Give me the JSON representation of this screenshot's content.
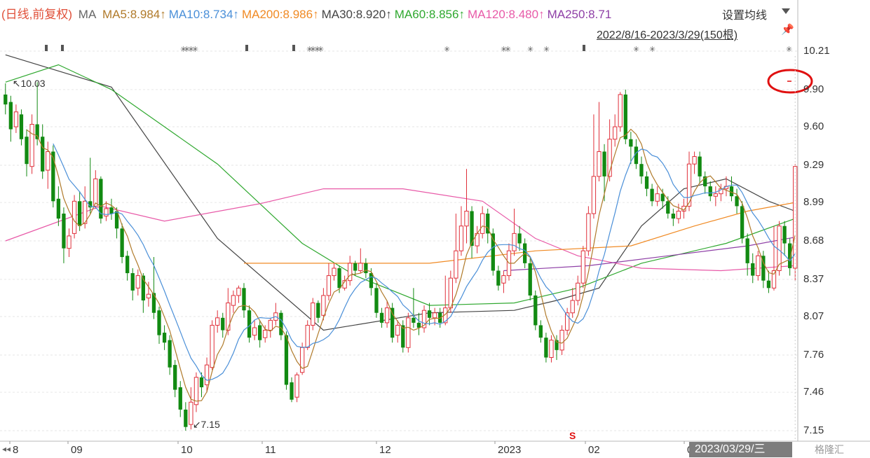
{
  "legend": {
    "mode_label": "(日线,前复权)",
    "ma_label": "MA",
    "items": [
      {
        "text": "MA5:8.984↑",
        "color": "#b07a2a"
      },
      {
        "text": "MA10:8.734↑",
        "color": "#4a8fd8"
      },
      {
        "text": "MA200:8.986↑",
        "color": "#f08a24"
      },
      {
        "text": "MA30:8.920↑",
        "color": "#444444"
      },
      {
        "text": "MA60:8.856↑",
        "color": "#2fa82f"
      },
      {
        "text": "MA120:8.480↑",
        "color": "#e85aa8"
      },
      {
        "text": "MA250:8.71",
        "color": "#8e3fa6"
      }
    ]
  },
  "settings_label": "设置均线",
  "date_range_label": "2022/8/16-2023/3/29(150根)",
  "pin_icon": "pin-icon",
  "cursor_date_label": "2023/03/29/三",
  "watermark": "格隆汇",
  "event_marker": "S",
  "colors": {
    "up": "#e0303a",
    "down": "#128a12",
    "highlight": "#e01010"
  },
  "chart_data": {
    "type": "candlestick",
    "y_ticks": [
      "10.21",
      "9.90",
      "9.60",
      "9.29",
      "8.99",
      "8.68",
      "8.37",
      "8.07",
      "7.76",
      "7.46",
      "7.15"
    ],
    "ylim": [
      7.15,
      10.21
    ],
    "x_labels": [
      "8",
      "09",
      "10",
      "11",
      "12",
      "2023",
      "02",
      "0"
    ],
    "annotations": {
      "high_label": "10.03",
      "low_label": "7.15"
    },
    "candles": [
      [
        9.86,
        9.78,
        9.95,
        9.7
      ],
      [
        9.8,
        9.58,
        9.85,
        9.48
      ],
      [
        9.6,
        9.72,
        9.78,
        9.55
      ],
      [
        9.7,
        9.5,
        9.74,
        9.45
      ],
      [
        9.52,
        9.3,
        9.58,
        9.2
      ],
      [
        9.28,
        9.62,
        9.7,
        9.22
      ],
      [
        9.62,
        9.5,
        9.96,
        9.45
      ],
      [
        9.52,
        9.24,
        9.62,
        9.18
      ],
      [
        9.25,
        9.4,
        9.48,
        9.1
      ],
      [
        9.4,
        9.0,
        9.45,
        8.95
      ],
      [
        9.02,
        8.86,
        9.12,
        8.8
      ],
      [
        8.9,
        8.62,
        8.95,
        8.5
      ],
      [
        8.62,
        8.72,
        8.78,
        8.55
      ],
      [
        8.74,
        9.0,
        9.05,
        8.7
      ],
      [
        9.0,
        8.8,
        9.08,
        8.76
      ],
      [
        8.82,
        9.0,
        9.12,
        8.78
      ],
      [
        9.0,
        8.95,
        9.35,
        8.9
      ],
      [
        8.96,
        9.18,
        9.25,
        8.94
      ],
      [
        9.18,
        8.86,
        9.2,
        8.82
      ],
      [
        8.88,
        8.94,
        9.0,
        8.84
      ],
      [
        8.95,
        8.9,
        9.02,
        8.85
      ],
      [
        8.92,
        8.78,
        8.95,
        8.7
      ],
      [
        8.78,
        8.55,
        8.82,
        8.5
      ],
      [
        8.56,
        8.42,
        8.6,
        8.36
      ],
      [
        8.42,
        8.28,
        8.46,
        8.2
      ],
      [
        8.3,
        8.4,
        8.45,
        8.24
      ],
      [
        8.4,
        8.2,
        8.42,
        8.1
      ],
      [
        8.22,
        8.25,
        8.35,
        8.15
      ],
      [
        8.26,
        8.1,
        8.55,
        8.05
      ],
      [
        8.12,
        7.92,
        8.15,
        7.85
      ],
      [
        7.94,
        7.86,
        8.0,
        7.8
      ],
      [
        7.88,
        7.66,
        7.92,
        7.6
      ],
      [
        7.68,
        7.48,
        7.72,
        7.42
      ],
      [
        7.5,
        7.32,
        7.55,
        7.26
      ],
      [
        7.32,
        7.18,
        7.38,
        7.15
      ],
      [
        7.2,
        7.38,
        7.5,
        7.16
      ],
      [
        7.36,
        7.58,
        7.62,
        7.3
      ],
      [
        7.58,
        7.5,
        7.62,
        7.42
      ],
      [
        7.52,
        7.68,
        7.74,
        7.46
      ],
      [
        7.66,
        8.0,
        8.04,
        7.64
      ],
      [
        8.0,
        8.06,
        8.12,
        7.94
      ],
      [
        8.06,
        7.96,
        8.1,
        7.9
      ],
      [
        7.96,
        8.18,
        8.3,
        7.92
      ],
      [
        8.16,
        8.24,
        8.28,
        8.1
      ],
      [
        8.24,
        8.3,
        8.32,
        8.18
      ],
      [
        8.3,
        8.12,
        8.34,
        8.06
      ],
      [
        8.12,
        7.9,
        8.16,
        7.86
      ],
      [
        7.92,
        7.98,
        8.04,
        7.88
      ],
      [
        8.0,
        7.88,
        8.04,
        7.82
      ],
      [
        7.9,
        7.96,
        8.0,
        7.86
      ],
      [
        7.96,
        8.04,
        8.06,
        7.9
      ],
      [
        8.04,
        8.1,
        8.18,
        8.0
      ],
      [
        8.1,
        7.92,
        8.12,
        7.88
      ],
      [
        7.92,
        7.52,
        7.95,
        7.48
      ],
      [
        7.54,
        7.4,
        7.58,
        7.38
      ],
      [
        7.42,
        7.6,
        7.62,
        7.38
      ],
      [
        7.62,
        7.82,
        7.86,
        7.6
      ],
      [
        7.82,
        8.0,
        8.04,
        7.8
      ],
      [
        8.0,
        8.18,
        8.22,
        7.96
      ],
      [
        8.18,
        8.06,
        8.2,
        8.02
      ],
      [
        8.08,
        8.24,
        8.3,
        8.04
      ],
      [
        8.24,
        8.4,
        8.5,
        8.2
      ],
      [
        8.4,
        8.46,
        8.5,
        8.36
      ],
      [
        8.46,
        8.3,
        8.48,
        8.26
      ],
      [
        8.3,
        8.36,
        8.4,
        8.28
      ],
      [
        8.36,
        8.5,
        8.56,
        8.32
      ],
      [
        8.5,
        8.44,
        8.52,
        8.4
      ],
      [
        8.44,
        8.5,
        8.62,
        8.42
      ],
      [
        8.5,
        8.42,
        8.54,
        8.38
      ],
      [
        8.42,
        8.3,
        8.46,
        8.24
      ],
      [
        8.3,
        8.1,
        8.34,
        8.06
      ],
      [
        8.1,
        8.02,
        8.14,
        7.98
      ],
      [
        8.02,
        8.14,
        8.2,
        7.98
      ],
      [
        8.14,
        7.9,
        8.18,
        7.86
      ],
      [
        7.92,
        8.0,
        8.04,
        7.86
      ],
      [
        8.0,
        7.82,
        8.04,
        7.78
      ],
      [
        7.82,
        8.06,
        8.1,
        7.78
      ],
      [
        8.06,
        8.02,
        8.3,
        7.98
      ],
      [
        8.02,
        7.98,
        8.1,
        7.92
      ],
      [
        7.98,
        8.12,
        8.16,
        7.94
      ],
      [
        8.12,
        8.06,
        8.18,
        8.0
      ],
      [
        8.06,
        8.1,
        8.14,
        8.0
      ],
      [
        8.1,
        8.02,
        8.14,
        7.98
      ],
      [
        8.02,
        8.14,
        8.4,
        8.0
      ],
      [
        8.14,
        8.38,
        8.44,
        8.1
      ],
      [
        8.38,
        8.6,
        8.9,
        8.34
      ],
      [
        8.6,
        8.8,
        8.96,
        8.56
      ],
      [
        8.8,
        8.92,
        9.26,
        8.66
      ],
      [
        8.92,
        8.64,
        8.96,
        8.54
      ],
      [
        8.64,
        8.74,
        8.8,
        8.58
      ],
      [
        8.74,
        8.9,
        8.96,
        8.7
      ],
      [
        8.9,
        8.74,
        8.94,
        8.66
      ],
      [
        8.74,
        8.44,
        8.78,
        8.4
      ],
      [
        8.44,
        8.32,
        8.48,
        8.28
      ],
      [
        8.34,
        8.4,
        8.44,
        8.26
      ],
      [
        8.4,
        8.6,
        8.66,
        8.36
      ],
      [
        8.6,
        8.74,
        8.94,
        8.56
      ],
      [
        8.74,
        8.66,
        8.8,
        8.6
      ],
      [
        8.66,
        8.5,
        8.7,
        8.46
      ],
      [
        8.5,
        8.24,
        8.54,
        8.2
      ],
      [
        8.24,
        8.0,
        8.28,
        7.96
      ],
      [
        8.0,
        7.9,
        8.04,
        7.86
      ],
      [
        7.9,
        7.74,
        7.94,
        7.7
      ],
      [
        7.74,
        7.88,
        7.92,
        7.7
      ],
      [
        7.88,
        7.8,
        7.92,
        7.72
      ],
      [
        7.8,
        7.96,
        8.0,
        7.76
      ],
      [
        7.96,
        8.1,
        8.14,
        7.92
      ],
      [
        8.1,
        8.2,
        8.3,
        8.06
      ],
      [
        8.2,
        8.34,
        8.4,
        8.16
      ],
      [
        8.34,
        8.6,
        8.64,
        8.3
      ],
      [
        8.6,
        8.9,
        8.96,
        8.56
      ],
      [
        8.9,
        9.2,
        9.7,
        8.86
      ],
      [
        9.2,
        9.4,
        9.8,
        9.16
      ],
      [
        9.4,
        9.2,
        9.46,
        9.0
      ],
      [
        9.2,
        9.5,
        9.66,
        9.16
      ],
      [
        9.5,
        9.6,
        9.7,
        9.44
      ],
      [
        9.6,
        9.86,
        9.88,
        9.56
      ],
      [
        9.86,
        9.5,
        9.9,
        9.46
      ],
      [
        9.5,
        9.44,
        9.56,
        9.3
      ],
      [
        9.44,
        9.3,
        9.5,
        9.26
      ],
      [
        9.3,
        9.2,
        9.36,
        9.14
      ],
      [
        9.2,
        9.1,
        9.24,
        9.04
      ],
      [
        9.1,
        9.0,
        9.14,
        8.96
      ],
      [
        9.0,
        9.06,
        9.12,
        8.96
      ],
      [
        9.06,
        9.0,
        9.1,
        8.94
      ],
      [
        9.0,
        8.9,
        9.04,
        8.86
      ],
      [
        8.9,
        8.86,
        8.94,
        8.8
      ],
      [
        8.86,
        8.92,
        8.98,
        8.82
      ],
      [
        8.92,
        8.96,
        9.02,
        8.86
      ],
      [
        8.96,
        9.3,
        9.4,
        8.92
      ],
      [
        9.3,
        9.36,
        9.4,
        9.22
      ],
      [
        9.36,
        9.2,
        9.4,
        9.14
      ],
      [
        9.2,
        9.12,
        9.24,
        9.06
      ],
      [
        9.12,
        9.04,
        9.16,
        9.0
      ],
      [
        9.04,
        9.06,
        9.12,
        8.96
      ],
      [
        9.06,
        9.1,
        9.14,
        9.0
      ],
      [
        9.1,
        9.12,
        9.2,
        9.04
      ],
      [
        9.12,
        9.04,
        9.2,
        9.0
      ],
      [
        9.04,
        8.96,
        9.1,
        8.9
      ],
      [
        8.96,
        8.7,
        9.0,
        8.66
      ],
      [
        8.7,
        8.5,
        8.74,
        8.4
      ],
      [
        8.5,
        8.4,
        8.58,
        8.34
      ],
      [
        8.4,
        8.56,
        8.6,
        8.36
      ],
      [
        8.56,
        8.36,
        8.6,
        8.3
      ],
      [
        8.36,
        8.3,
        8.44,
        8.26
      ],
      [
        8.3,
        8.44,
        8.8,
        8.28
      ],
      [
        8.44,
        8.8,
        8.84,
        8.4
      ],
      [
        8.8,
        8.66,
        8.84,
        8.56
      ],
      [
        8.66,
        8.46,
        8.7,
        8.4
      ],
      [
        8.46,
        9.28,
        9.3,
        8.36
      ]
    ],
    "ma_series": [
      {
        "name": "MA30",
        "color": "#444444",
        "points": [
          [
            0,
            10.18
          ],
          [
            20,
            9.92
          ],
          [
            40,
            8.7
          ],
          [
            60,
            7.96
          ],
          [
            80,
            8.1
          ],
          [
            96,
            8.12
          ],
          [
            104,
            8.2
          ],
          [
            112,
            8.3
          ],
          [
            120,
            8.8
          ],
          [
            128,
            9.1
          ],
          [
            136,
            9.18
          ],
          [
            144,
            9.0
          ],
          [
            149,
            8.92
          ]
        ]
      },
      {
        "name": "MA60",
        "color": "#2fa82f",
        "points": [
          [
            0,
            9.96
          ],
          [
            10,
            10.1
          ],
          [
            20,
            9.9
          ],
          [
            40,
            9.3
          ],
          [
            56,
            8.66
          ],
          [
            66,
            8.4
          ],
          [
            80,
            8.16
          ],
          [
            96,
            8.18
          ],
          [
            108,
            8.3
          ],
          [
            120,
            8.5
          ],
          [
            136,
            8.66
          ],
          [
            149,
            8.86
          ]
        ]
      },
      {
        "name": "MA120",
        "color": "#e85aa8",
        "points": [
          [
            0,
            8.68
          ],
          [
            18,
            8.96
          ],
          [
            30,
            8.84
          ],
          [
            48,
            8.98
          ],
          [
            60,
            9.1
          ],
          [
            75,
            9.1
          ],
          [
            90,
            9.0
          ],
          [
            100,
            8.7
          ],
          [
            108,
            8.56
          ],
          [
            120,
            8.46
          ],
          [
            135,
            8.44
          ],
          [
            149,
            8.48
          ]
        ]
      },
      {
        "name": "MA200",
        "color": "#f08a24",
        "points": [
          [
            45,
            8.5
          ],
          [
            80,
            8.5
          ],
          [
            100,
            8.6
          ],
          [
            118,
            8.64
          ],
          [
            130,
            8.8
          ],
          [
            140,
            8.92
          ],
          [
            149,
            8.99
          ]
        ]
      },
      {
        "name": "MA250",
        "color": "#8e3fa6",
        "points": [
          [
            94,
            8.44
          ],
          [
            110,
            8.48
          ],
          [
            125,
            8.56
          ],
          [
            140,
            8.64
          ],
          [
            149,
            8.71
          ]
        ]
      }
    ]
  }
}
